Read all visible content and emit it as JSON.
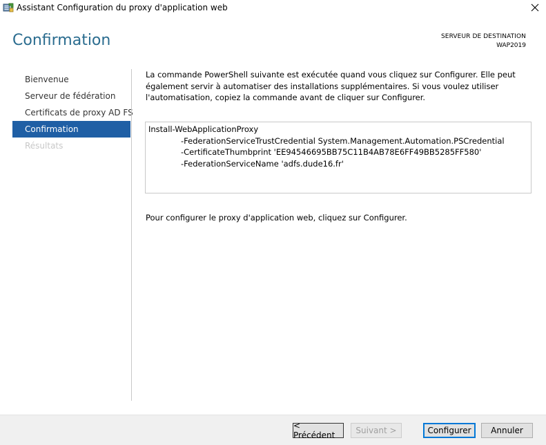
{
  "window": {
    "title": "Assistant Configuration du proxy d'application web",
    "close_glyph": "✕"
  },
  "header": {
    "page_title": "Confirmation",
    "destination_label": "SERVEUR DE DESTINATION",
    "destination_server": "WAP2019"
  },
  "nav": {
    "items": [
      {
        "label": "Bienvenue",
        "state": "normal"
      },
      {
        "label": "Serveur de fédération",
        "state": "normal"
      },
      {
        "label": "Certificats de proxy AD FS",
        "state": "normal"
      },
      {
        "label": "Confirmation",
        "state": "active"
      },
      {
        "label": "Résultats",
        "state": "disabled"
      }
    ]
  },
  "content": {
    "intro": "La commande PowerShell suivante est exécutée quand vous cliquez sur Configurer. Elle peut également servir à automatiser des installations supplémentaires. Si vous voulez utiliser l'automatisation, copiez la commande avant de cliquer sur Configurer.",
    "command_lines": [
      "Install-WebApplicationProxy",
      "-FederationServiceTrustCredential System.Management.Automation.PSCredential",
      "-CertificateThumbprint 'EE94546695BB75C11B4AB78E6FF49BB5285FF580'",
      "-FederationServiceName 'adfs.dude16.fr'"
    ],
    "footer": "Pour configurer le proxy d'application web, cliquez sur Configurer."
  },
  "buttons": {
    "previous": "< Précédent",
    "next": "Suivant >",
    "configure": "Configurer",
    "cancel": "Annuler"
  },
  "colors": {
    "title_accent": "#2a6c8f",
    "nav_active_bg": "#1f5fa5",
    "nav_disabled_text": "#c8c8c8"
  },
  "icons": {
    "app": "server-wizard-icon",
    "close": "close-icon"
  }
}
